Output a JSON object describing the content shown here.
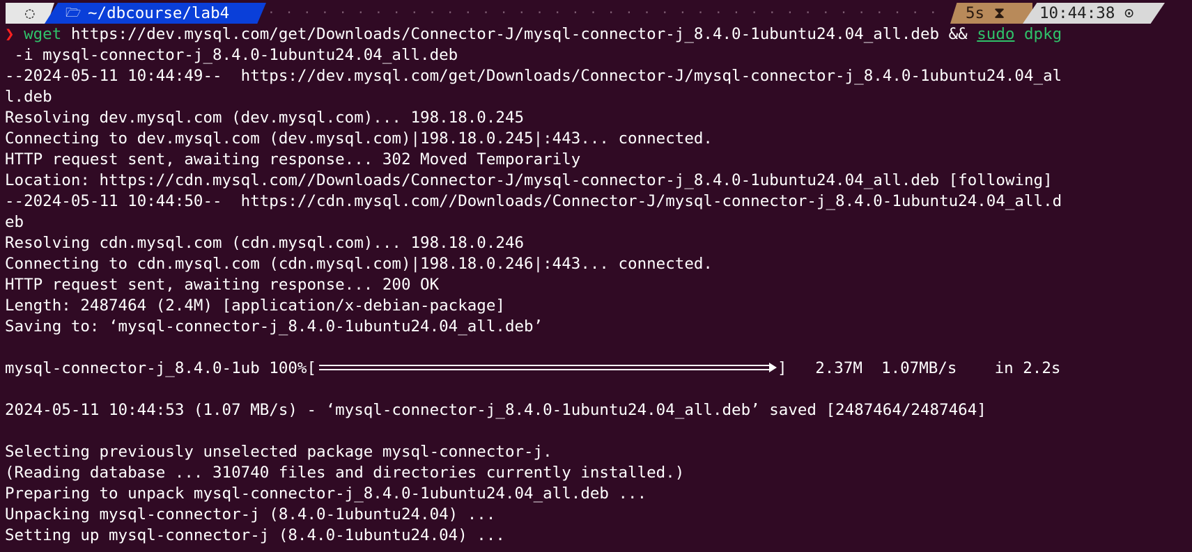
{
  "prompt": {
    "os_icon": "ubuntu-icon",
    "folder_icon": "folder-icon",
    "path": "~/dbcourse/lab4",
    "dots": "· · · · · · · · · · · · · · · · · · · · · · · · · · · · · · · · · · · · · · · · · · · · · · · · · · · · · · · · · · · · · · · · · · · · · · · · · · · · · · · · · · · · · · · · · · · · · · · · · · · · · · · · ·",
    "duration": "5s ⧗",
    "clock": "10:44:38 ⊙",
    "chevron": "❯"
  },
  "command": {
    "wget": "wget",
    "wget_args": " https://dev.mysql.com/get/Downloads/Connector-J/mysql-connector-j_8.4.0-1ubuntu24.04_all.deb && ",
    "sudo": "sudo",
    "space": " ",
    "dpkg": "dpkg",
    "continuation": " -i mysql-connector-j_8.4.0-1ubuntu24.04_all.deb"
  },
  "output": {
    "l1": "--2024-05-11 10:44:49--  https://dev.mysql.com/get/Downloads/Connector-J/mysql-connector-j_8.4.0-1ubuntu24.04_al",
    "l2": "l.deb",
    "l3": "Resolving dev.mysql.com (dev.mysql.com)... 198.18.0.245",
    "l4": "Connecting to dev.mysql.com (dev.mysql.com)|198.18.0.245|:443... connected.",
    "l5": "HTTP request sent, awaiting response... 302 Moved Temporarily",
    "l6": "Location: https://cdn.mysql.com//Downloads/Connector-J/mysql-connector-j_8.4.0-1ubuntu24.04_all.deb [following]",
    "l7": "--2024-05-11 10:44:50--  https://cdn.mysql.com//Downloads/Connector-J/mysql-connector-j_8.4.0-1ubuntu24.04_all.d",
    "l8": "eb",
    "l9": "Resolving cdn.mysql.com (cdn.mysql.com)... 198.18.0.246",
    "l10": "Connecting to cdn.mysql.com (cdn.mysql.com)|198.18.0.246|:443... connected.",
    "l11": "HTTP request sent, awaiting response... 200 OK",
    "l12": "Length: 2487464 (2.4M) [application/x-debian-package]",
    "l13": "Saving to: ‘mysql-connector-j_8.4.0-1ubuntu24.04_all.deb’",
    "progress_name": "mysql-connector-j_8.4.0-1ub 100%[",
    "progress_percent": 100,
    "progress_tail": "]   2.37M  1.07MB/s    in 2.2s",
    "l15": "2024-05-11 10:44:53 (1.07 MB/s) - ‘mysql-connector-j_8.4.0-1ubuntu24.04_all.deb’ saved [2487464/2487464]",
    "l16": "Selecting previously unselected package mysql-connector-j.",
    "l17": "(Reading database ... 310740 files and directories currently installed.)",
    "l18": "Preparing to unpack mysql-connector-j_8.4.0-1ubuntu24.04_all.deb ...",
    "l19": "Unpacking mysql-connector-j (8.4.0-1ubuntu24.04) ...",
    "l20": "Setting up mysql-connector-j (8.4.0-1ubuntu24.04) ..."
  },
  "colors": {
    "background": "#300a24",
    "text": "#ffffff",
    "command_green": "#2fc26a",
    "prompt_chevron": "#ff2020",
    "path_segment": "#0a3fd9",
    "duration_segment": "#b88a5a",
    "clock_segment": "#d9d9d9"
  }
}
